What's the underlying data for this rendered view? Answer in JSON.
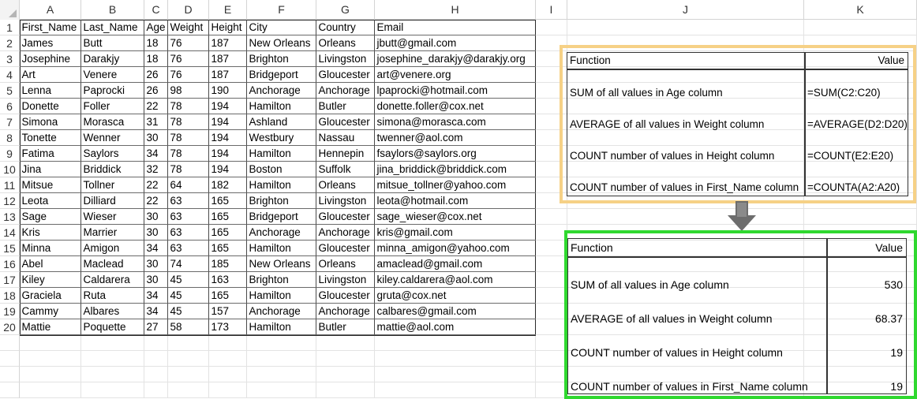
{
  "sheet": {
    "columns": [
      "A",
      "B",
      "C",
      "D",
      "E",
      "F",
      "G",
      "H",
      "I",
      "J",
      "K"
    ],
    "row_numbers": [
      "1",
      "2",
      "3",
      "4",
      "5",
      "6",
      "7",
      "8",
      "9",
      "10",
      "11",
      "12",
      "13",
      "14",
      "15",
      "16",
      "17",
      "18",
      "19",
      "20"
    ],
    "headers": [
      "First_Name",
      "Last_Name",
      "Age",
      "Weight",
      "Height",
      "City",
      "Country",
      "Email"
    ],
    "rows": [
      [
        "James",
        "Butt",
        "18",
        "76",
        "187",
        "New Orleans",
        "Orleans",
        "jbutt@gmail.com"
      ],
      [
        "Josephine",
        "Darakjy",
        "18",
        "76",
        "187",
        "Brighton",
        "Livingston",
        "josephine_darakjy@darakjy.org"
      ],
      [
        "Art",
        "Venere",
        "26",
        "76",
        "187",
        "Bridgeport",
        "Gloucester",
        "art@venere.org"
      ],
      [
        "Lenna",
        "Paprocki",
        "26",
        "98",
        "190",
        "Anchorage",
        "Anchorage",
        "lpaprocki@hotmail.com"
      ],
      [
        "Donette",
        "Foller",
        "22",
        "78",
        "194",
        "Hamilton",
        "Butler",
        "donette.foller@cox.net"
      ],
      [
        "Simona",
        "Morasca",
        "31",
        "78",
        "194",
        "Ashland",
        "Gloucester",
        "simona@morasca.com"
      ],
      [
        "Tonette",
        "Wenner",
        "30",
        "78",
        "194",
        "Westbury",
        "Nassau",
        "twenner@aol.com"
      ],
      [
        "Fatima",
        "Saylors",
        "34",
        "78",
        "194",
        "Hamilton",
        "Hennepin",
        "fsaylors@saylors.org"
      ],
      [
        "Jina",
        "Briddick",
        "32",
        "78",
        "194",
        "Boston",
        "Suffolk",
        "jina_briddick@briddick.com"
      ],
      [
        "Mitsue",
        "Tollner",
        "22",
        "64",
        "182",
        "Hamilton",
        "Orleans",
        "mitsue_tollner@yahoo.com"
      ],
      [
        "Leota",
        "Dilliard",
        "22",
        "63",
        "165",
        "Brighton",
        "Livingston",
        "leota@hotmail.com"
      ],
      [
        "Sage",
        "Wieser",
        "30",
        "63",
        "165",
        "Bridgeport",
        "Gloucester",
        "sage_wieser@cox.net"
      ],
      [
        "Kris",
        "Marrier",
        "30",
        "63",
        "165",
        "Anchorage",
        "Anchorage",
        "kris@gmail.com"
      ],
      [
        "Minna",
        "Amigon",
        "34",
        "63",
        "165",
        "Hamilton",
        "Gloucester",
        "minna_amigon@yahoo.com"
      ],
      [
        "Abel",
        "Maclead",
        "30",
        "74",
        "185",
        "New Orleans",
        "Orleans",
        "amaclead@gmail.com"
      ],
      [
        "Kiley",
        "Caldarera",
        "30",
        "45",
        "163",
        "Brighton",
        "Livingston",
        "kiley.caldarera@aol.com"
      ],
      [
        "Graciela",
        "Ruta",
        "34",
        "45",
        "165",
        "Hamilton",
        "Gloucester",
        "gruta@cox.net"
      ],
      [
        "Cammy",
        "Albares",
        "34",
        "45",
        "157",
        "Anchorage",
        "Anchorage",
        "calbares@gmail.com"
      ],
      [
        "Mattie",
        "Poquette",
        "27",
        "58",
        "173",
        "Hamilton",
        "Butler",
        "mattie@aol.com"
      ]
    ]
  },
  "formulas": {
    "header_function": "Function",
    "header_value": "Value",
    "rows": [
      {
        "label": "SUM of all values in Age column",
        "value": "=SUM(C2:C20)"
      },
      {
        "label": "AVERAGE of all values in Weight column",
        "value": "=AVERAGE(D2:D20)"
      },
      {
        "label": "COUNT number of values in Height column",
        "value": "=COUNT(E2:E20)"
      },
      {
        "label": "COUNT number of values in First_Name column",
        "value": "=COUNTA(A2:A20)"
      }
    ]
  },
  "results": {
    "header_function": "Function",
    "header_value": "Value",
    "rows": [
      {
        "label": "SUM of all values in Age column",
        "value": "530"
      },
      {
        "label": "AVERAGE of all values in Weight column",
        "value": "68.37"
      },
      {
        "label": "COUNT number of values in Height column",
        "value": "19"
      },
      {
        "label": "COUNT number of values in First_Name column",
        "value": "19"
      }
    ]
  },
  "colors": {
    "formula_frame": "#f6d186",
    "result_frame": "#2fd82f",
    "arrow": "#6d6d6d"
  },
  "icons": {
    "arrow": "down-arrow-icon",
    "corner": "select-all-triangle-icon"
  }
}
